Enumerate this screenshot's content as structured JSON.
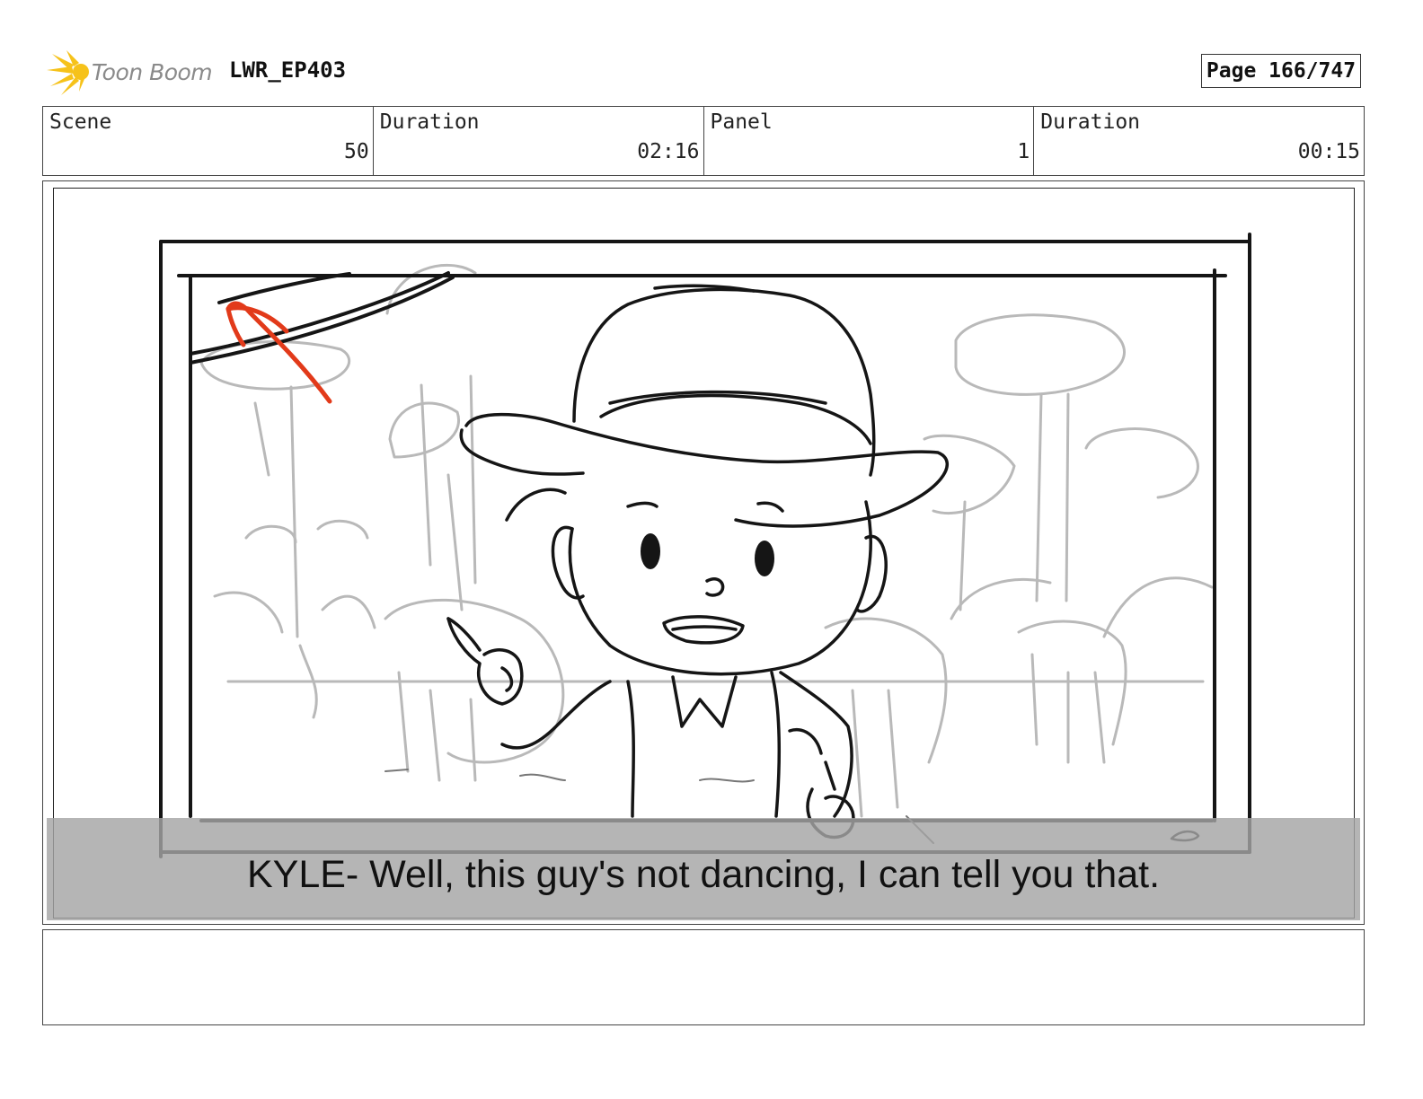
{
  "header": {
    "logo_text": "Toon Boom",
    "project": "LWR_EP403",
    "page": "Page 166/747"
  },
  "info": {
    "scene_label": "Scene",
    "scene_value": "50",
    "scene_duration_label": "Duration",
    "scene_duration_value": "02:16",
    "panel_label": "Panel",
    "panel_value": "1",
    "panel_duration_label": "Duration",
    "panel_duration_value": "00:15"
  },
  "panel": {
    "caption": "KYLE- Well, this guy's not dancing, I can tell you that."
  },
  "notes": {
    "text": ""
  }
}
